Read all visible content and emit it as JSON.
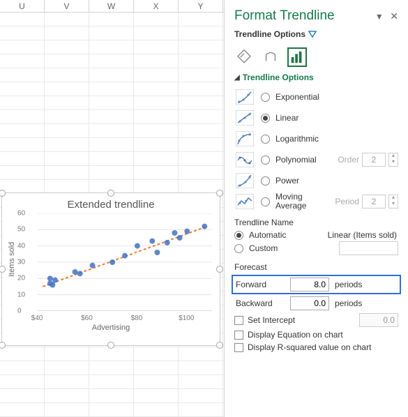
{
  "columns": [
    "U",
    "V",
    "W",
    "X",
    "Y"
  ],
  "pane": {
    "title": "Format Trendline",
    "subheader": "Trendline Options",
    "section": "Trendline Options",
    "types": {
      "exponential": "Exponential",
      "linear": "Linear",
      "logarithmic": "Logarithmic",
      "polynomial": "Polynomial",
      "power": "Power",
      "moving_l1": "Moving",
      "moving_l2": "Average"
    },
    "order_label": "Order",
    "order_value": "2",
    "period_label": "Period",
    "period_value": "2",
    "name_label": "Trendline Name",
    "automatic": "Automatic",
    "auto_value": "Linear (Items sold)",
    "custom": "Custom",
    "forecast_label": "Forecast",
    "forward": "Forward",
    "forward_value": "8.0",
    "backward": "Backward",
    "backward_value": "0.0",
    "periods": "periods",
    "set_intercept": "Set Intercept",
    "intercept_value": "0.0",
    "display_eq": "Display Equation on chart",
    "display_r2": "Display R-squared value on chart"
  },
  "chart_data": {
    "type": "scatter",
    "title": "Extended trendline",
    "xlabel": "Advertising",
    "ylabel": "Items sold",
    "xlim": [
      40,
      110
    ],
    "ylim": [
      0,
      60
    ],
    "xticks": [
      "$40",
      "$60",
      "$80",
      "$100"
    ],
    "yticks": [
      0,
      10,
      20,
      30,
      40,
      50,
      60
    ],
    "points": [
      {
        "x": 45,
        "y": 17
      },
      {
        "x": 45,
        "y": 20
      },
      {
        "x": 46,
        "y": 16
      },
      {
        "x": 47,
        "y": 19
      },
      {
        "x": 55,
        "y": 24
      },
      {
        "x": 57,
        "y": 23
      },
      {
        "x": 62,
        "y": 28
      },
      {
        "x": 70,
        "y": 30
      },
      {
        "x": 75,
        "y": 34
      },
      {
        "x": 80,
        "y": 40
      },
      {
        "x": 86,
        "y": 43
      },
      {
        "x": 88,
        "y": 36
      },
      {
        "x": 92,
        "y": 42
      },
      {
        "x": 95,
        "y": 48
      },
      {
        "x": 97,
        "y": 45
      },
      {
        "x": 100,
        "y": 49
      },
      {
        "x": 107,
        "y": 52
      }
    ],
    "trendline": {
      "x1": 42,
      "y1": 15,
      "x2": 108,
      "y2": 52
    }
  }
}
